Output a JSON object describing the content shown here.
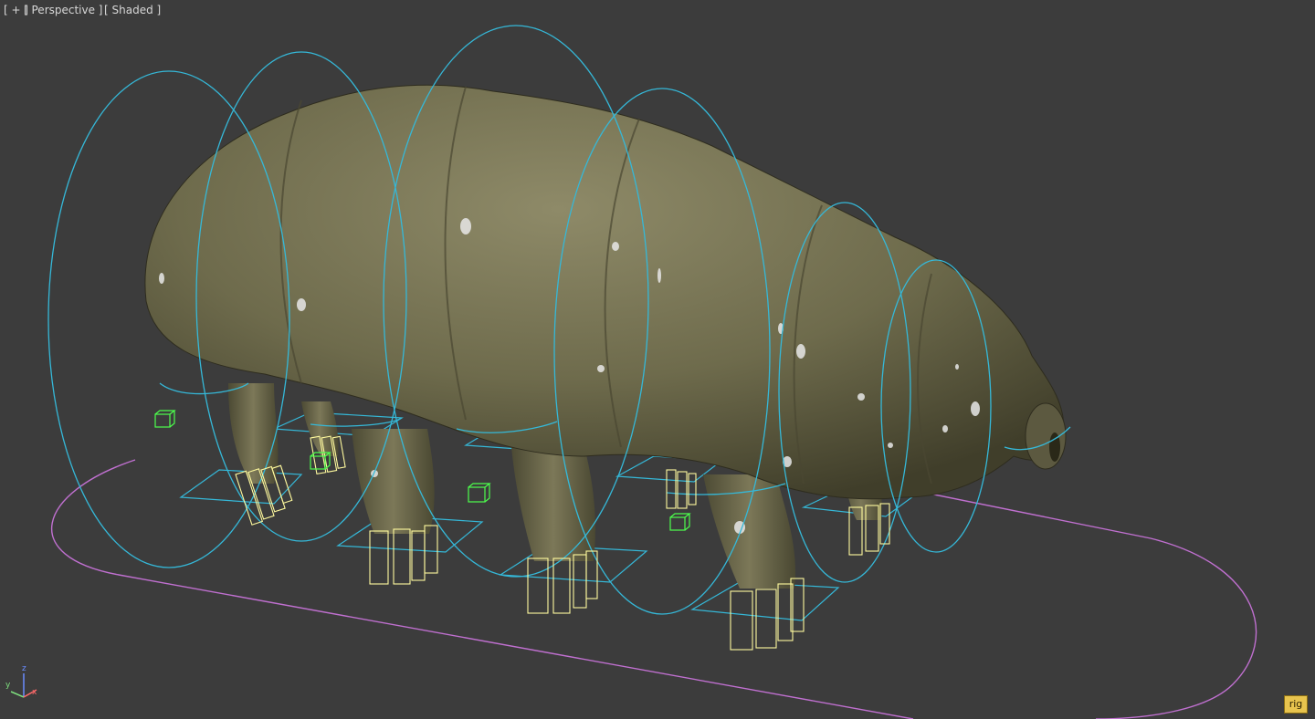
{
  "viewport": {
    "plus_label": "[ + ]",
    "view_label": "[ Perspective ]",
    "shading_label": "[ Shaded ]"
  },
  "gizmo": {
    "z": "z",
    "y": "y",
    "x": "x"
  },
  "badge": {
    "label": "rig"
  },
  "colors": {
    "background": "#3c3c3c",
    "rig_circle": "#35b8d8",
    "foot_box": "#fffa9e",
    "bone_box": "#4cff4c",
    "ground_spline": "#c070d0",
    "skin": "#6e6b4c",
    "badge": "#e8c44e"
  },
  "icons": [
    "axis-gizmo-icon",
    "rig-badge-icon"
  ]
}
